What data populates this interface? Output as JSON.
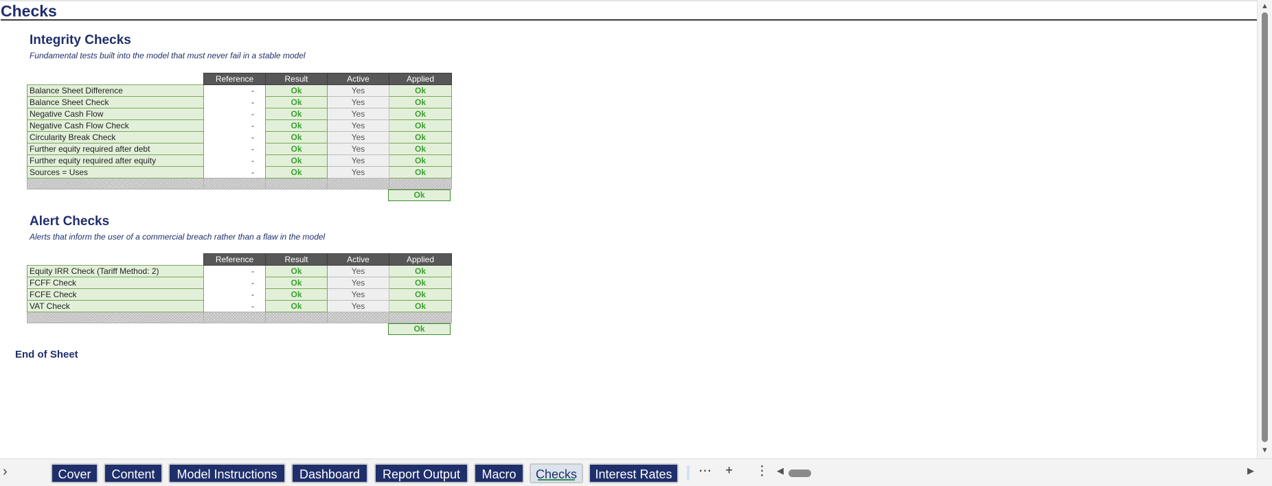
{
  "sheet": {
    "title": "Checks",
    "columns": {
      "reference": "Reference",
      "result": "Result",
      "active": "Active",
      "applied": "Applied"
    }
  },
  "integrity": {
    "title": "Integrity Checks",
    "subtitle": "Fundamental tests built into the model that must never fail in a stable model",
    "rows": [
      {
        "label": "Balance Sheet Difference",
        "reference": "-",
        "result": "Ok",
        "active": "Yes",
        "applied": "Ok"
      },
      {
        "label": "Balance Sheet Check",
        "reference": "-",
        "result": "Ok",
        "active": "Yes",
        "applied": "Ok"
      },
      {
        "label": "Negative Cash Flow",
        "reference": "-",
        "result": "Ok",
        "active": "Yes",
        "applied": "Ok"
      },
      {
        "label": "Negative Cash Flow Check",
        "reference": "-",
        "result": "Ok",
        "active": "Yes",
        "applied": "Ok"
      },
      {
        "label": "Circularity Break Check",
        "reference": "-",
        "result": "Ok",
        "active": "Yes",
        "applied": "Ok"
      },
      {
        "label": "Further equity required after debt",
        "reference": "-",
        "result": "Ok",
        "active": "Yes",
        "applied": "Ok"
      },
      {
        "label": "Further equity required after equity",
        "reference": "-",
        "result": "Ok",
        "active": "Yes",
        "applied": "Ok"
      },
      {
        "label": "Sources = Uses",
        "reference": "-",
        "result": "Ok",
        "active": "Yes",
        "applied": "Ok"
      }
    ],
    "summary": "Ok"
  },
  "alert": {
    "title": "Alert Checks",
    "subtitle": "Alerts that inform the user of a commercial breach rather than a flaw in the model",
    "rows": [
      {
        "label": "Equity IRR Check (Tariff Method: 2)",
        "reference": "-",
        "result": "Ok",
        "active": "Yes",
        "applied": "Ok"
      },
      {
        "label": "FCFF Check",
        "reference": "-",
        "result": "Ok",
        "active": "Yes",
        "applied": "Ok"
      },
      {
        "label": "FCFE Check",
        "reference": "-",
        "result": "Ok",
        "active": "Yes",
        "applied": "Ok"
      },
      {
        "label": "VAT Check",
        "reference": "-",
        "result": "Ok",
        "active": "Yes",
        "applied": "Ok"
      }
    ],
    "summary": "Ok"
  },
  "end_text": "End of Sheet",
  "tabs": [
    "Cover",
    "Content",
    "Model Instructions",
    "Dashboard",
    "Report Output",
    "Macro",
    "Checks",
    "Interest Rates"
  ],
  "active_tab": "Checks",
  "icons": {
    "expand": "chevron-right-icon",
    "more": "ellipsis-icon",
    "add": "plus-icon",
    "options": "vertical-ellipsis-icon",
    "scroll_left": "triangle-left-icon",
    "scroll_right": "triangle-right-icon"
  },
  "colors": {
    "title_navy": "#1f2f6b",
    "tab_navy": "#1f2f6b",
    "ok_green": "#3aa12f",
    "cell_green": "#e2f0d9",
    "header_gray": "#575757"
  }
}
